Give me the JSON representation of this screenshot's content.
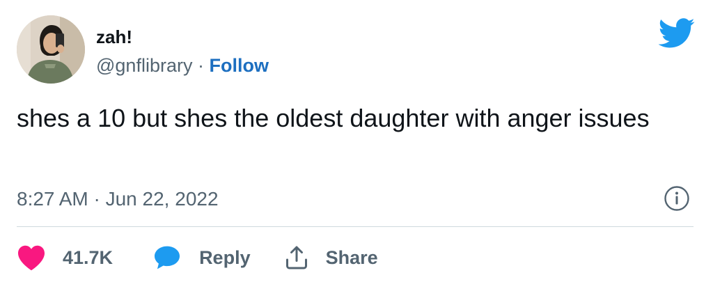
{
  "author": {
    "name": "zah!",
    "handle": "@gnflibrary",
    "separator": "·",
    "follow_label": "Follow"
  },
  "tweet": {
    "text": "shes a 10 but shes the oldest daughter with anger issues",
    "timestamp": "8:27 AM · Jun 22, 2022"
  },
  "actions": {
    "like_count": "41.7K",
    "reply_label": "Reply",
    "share_label": "Share"
  },
  "icons": {
    "brand": "twitter-bird-icon",
    "info": "info-icon",
    "like": "heart-icon",
    "reply": "speech-bubble-icon",
    "share": "share-upload-icon"
  },
  "colors": {
    "twitter_blue": "#1d9bf0",
    "follow_blue": "#1d6fc0",
    "like_pink": "#f91880",
    "muted_text": "#536471",
    "divider": "#cfd9de"
  }
}
